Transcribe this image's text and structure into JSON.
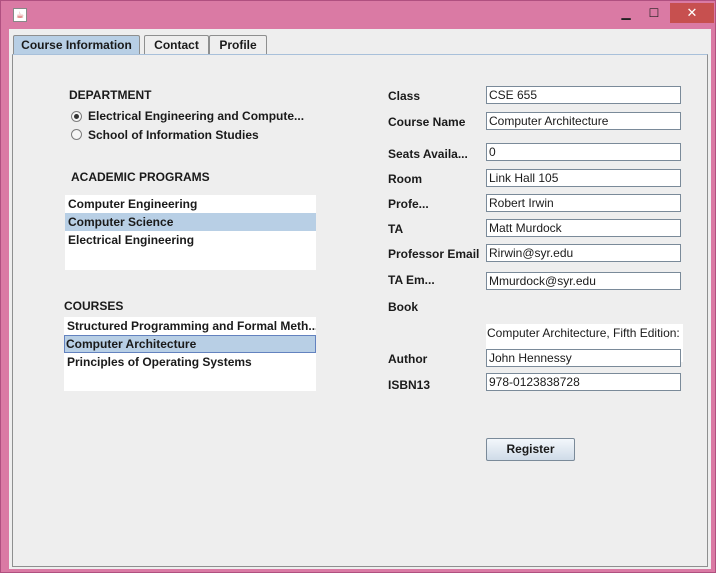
{
  "window": {
    "app_icon": "java-cup-icon",
    "minimize_icon": "minimize-icon",
    "maximize_icon": "maximize-icon",
    "close_icon": "close-icon"
  },
  "tabs": [
    {
      "label": "Course Information",
      "active": true
    },
    {
      "label": "Contact",
      "active": false
    },
    {
      "label": "Profile",
      "active": false
    }
  ],
  "department": {
    "heading": "DEPARTMENT",
    "options": [
      {
        "label": "Electrical Engineering and Compute...",
        "selected": true
      },
      {
        "label": "School of Information Studies",
        "selected": false
      }
    ]
  },
  "programs": {
    "heading": "ACADEMIC PROGRAMS",
    "items": [
      {
        "label": "Computer Engineering",
        "selected": false
      },
      {
        "label": "Computer Science",
        "selected": true
      },
      {
        "label": "Electrical Engineering",
        "selected": false
      }
    ]
  },
  "courses": {
    "heading": "COURSES",
    "items": [
      {
        "label": "Structured Programming and Formal Meth...",
        "selected": false
      },
      {
        "label": "Computer Architecture",
        "selected": true
      },
      {
        "label": "Principles of Operating Systems",
        "selected": false
      }
    ]
  },
  "form": {
    "class_label": "Class",
    "class_value": "CSE 655",
    "course_name_label": "Course Name",
    "course_name_value": "Computer Architecture",
    "seats_label": "Seats Availa...",
    "seats_value": "0",
    "room_label": "Room",
    "room_value": "Link Hall 105",
    "professor_label": "Profe...",
    "professor_value": "Robert Irwin",
    "ta_label": "TA",
    "ta_value": "Matt Murdock",
    "professor_email_label": "Professor Email",
    "professor_email_value": "Rirwin@syr.edu",
    "ta_email_label": "TA Em...",
    "ta_email_value": "Mmurdock@syr.edu",
    "book_label": "Book",
    "book_value": "Computer Architecture, Fifth Edition:",
    "author_label": "Author",
    "author_value": "John Hennessy",
    "isbn_label": "ISBN13",
    "isbn_value": "978-0123838728",
    "register_label": "Register"
  }
}
